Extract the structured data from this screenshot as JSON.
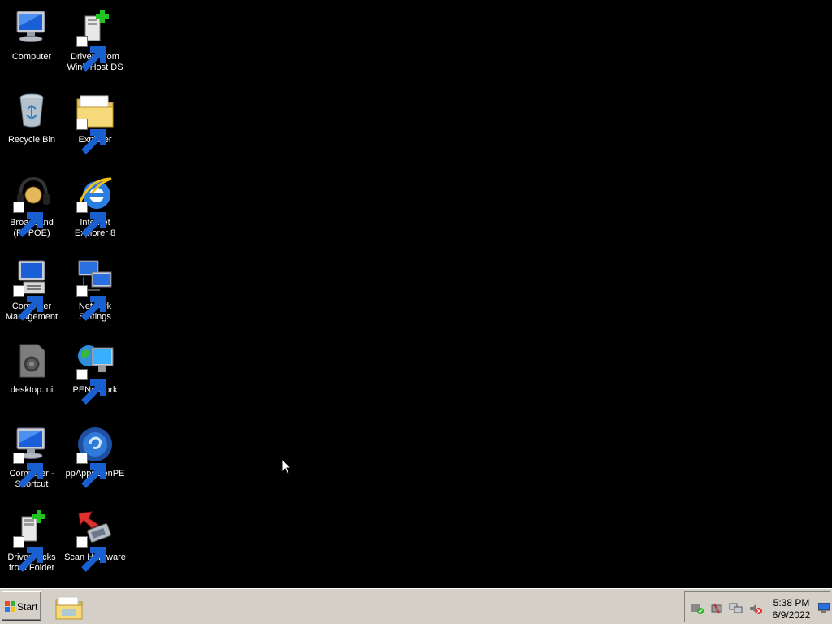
{
  "desktop": {
    "icons": [
      {
        "label": "Computer",
        "icon": "computer-icon",
        "shortcut": false
      },
      {
        "label": "Drivers from Win7 Host DS",
        "icon": "driver-pack-icon",
        "shortcut": true
      },
      {
        "label": "Recycle Bin",
        "icon": "recycle-bin-icon",
        "shortcut": false
      },
      {
        "label": "Explorer",
        "icon": "folder-icon",
        "shortcut": true
      },
      {
        "label": "Broadband (PPPOE)",
        "icon": "headset-icon",
        "shortcut": true
      },
      {
        "label": "Internet Explorer 8",
        "icon": "internet-explorer-icon",
        "shortcut": true
      },
      {
        "label": "Computer Management",
        "icon": "computer-management-icon",
        "shortcut": true
      },
      {
        "label": "Network Settings",
        "icon": "network-settings-icon",
        "shortcut": true
      },
      {
        "label": "desktop.ini",
        "icon": "settings-file-icon",
        "shortcut": false
      },
      {
        "label": "PENetwork",
        "icon": "globe-monitor-icon",
        "shortcut": true
      },
      {
        "label": "Computer - Shortcut",
        "icon": "computer-icon",
        "shortcut": true
      },
      {
        "label": "ppAppsGenPE",
        "icon": "blue-orb-icon",
        "shortcut": true
      },
      {
        "label": "DriverPacks from Folder",
        "icon": "driver-pack-icon",
        "shortcut": true
      },
      {
        "label": "Scan Hardware",
        "icon": "scan-hardware-icon",
        "shortcut": true
      }
    ]
  },
  "taskbar": {
    "start_label": "Start",
    "quick_launch": [
      {
        "icon": "folder-icon",
        "label": "Explorer"
      }
    ],
    "tray_icons": [
      "safely-remove-hardware-icon",
      "usb-device-icon",
      "network-connection-icon",
      "volume-muted-icon"
    ],
    "clock": {
      "time": "5:38 PM",
      "date": "6/9/2022"
    }
  },
  "colors": {
    "desktop_background": "#000000",
    "taskbar": "#d4d0c8",
    "text": "#ffffff"
  }
}
